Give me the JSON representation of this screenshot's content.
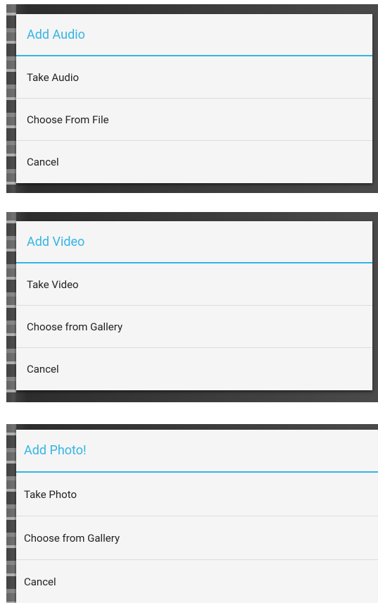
{
  "dialogs": [
    {
      "title": "Add Audio",
      "options": [
        "Take Audio",
        "Choose From File",
        "Cancel"
      ]
    },
    {
      "title": "Add Video",
      "options": [
        "Take Video",
        "Choose from Gallery",
        "Cancel"
      ]
    },
    {
      "title": "Add Photo!",
      "options": [
        "Take Photo",
        "Choose from Gallery",
        "Cancel"
      ]
    }
  ],
  "colors": {
    "accent": "#33b5e5",
    "dialog_bg": "#f5f5f5",
    "text": "#222222",
    "divider": "#dcdcdc"
  }
}
